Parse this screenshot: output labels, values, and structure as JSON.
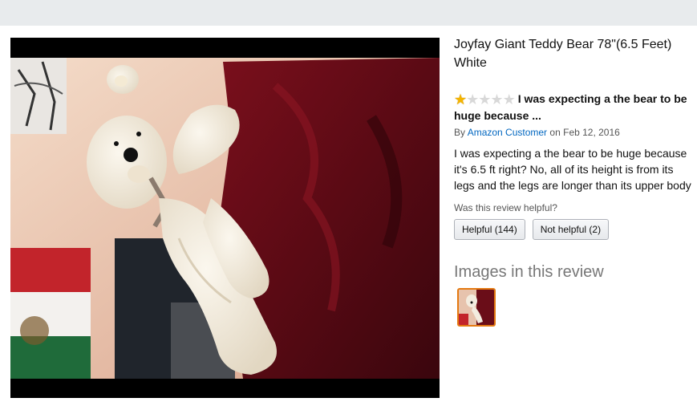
{
  "colors": {
    "top_bar": "#e8ebed",
    "link": "#0066c0",
    "star": "#f4b400",
    "thumb_border": "#e47911"
  },
  "product": {
    "title": "Joyfay Giant Teddy Bear 78\"(6.5 Feet) White"
  },
  "review": {
    "rating": 1,
    "max_rating": 5,
    "headline": "I was expecting a the bear to be huge because ...",
    "by_prefix": "By",
    "author": "Amazon Customer",
    "date_prefix": "on",
    "date": "Feb 12, 2016",
    "body": "I was expecting a the bear to be huge because it's 6.5 ft right? No, all of its height is from its legs and the legs are longer than its upper body",
    "helpful_question": "Was this review helpful?",
    "helpful_button": "Helpful (144)",
    "not_helpful_button": "Not helpful (2)"
  },
  "images_section": {
    "title": "Images in this review"
  },
  "icons": {
    "star_filled": "star-filled-icon",
    "star_empty": "star-empty-icon"
  }
}
